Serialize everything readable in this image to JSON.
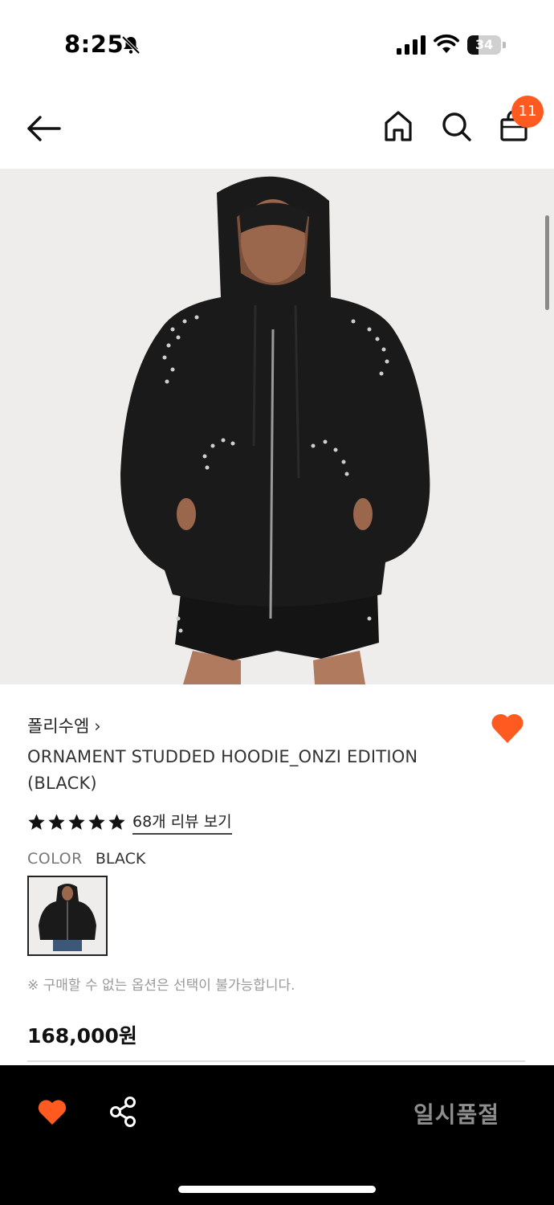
{
  "status": {
    "time": "8:25",
    "battery": "34",
    "battery_level": 0.34
  },
  "nav": {
    "cart_count": "11"
  },
  "product": {
    "brand": "폴리수엠",
    "brand_chevron": "›",
    "title": "ORNAMENT STUDDED HOODIE_ONZI EDITION (BLACK)",
    "rating": 5,
    "review_link": "68개 리뷰 보기",
    "color_label": "COLOR",
    "color_value": "BLACK",
    "notice": "※ 구매할 수 없는 옵션은 선택이 불가능합니다.",
    "price": "168,000원"
  },
  "bottom_bar": {
    "sold_out_label": "일시품절"
  },
  "colors": {
    "accent": "#ff5a1f",
    "bottom_bar_bg": "#000000",
    "sold_out_text": "#8e8e8e"
  },
  "icons": {
    "back": "arrow-left-icon",
    "home": "home-icon",
    "search": "search-icon",
    "cart": "shopping-bag-icon",
    "wishlist": "heart-icon",
    "share": "share-icon",
    "mute": "bell-slash-icon",
    "signal": "cellular-signal-icon",
    "wifi": "wifi-icon",
    "battery": "battery-icon"
  }
}
